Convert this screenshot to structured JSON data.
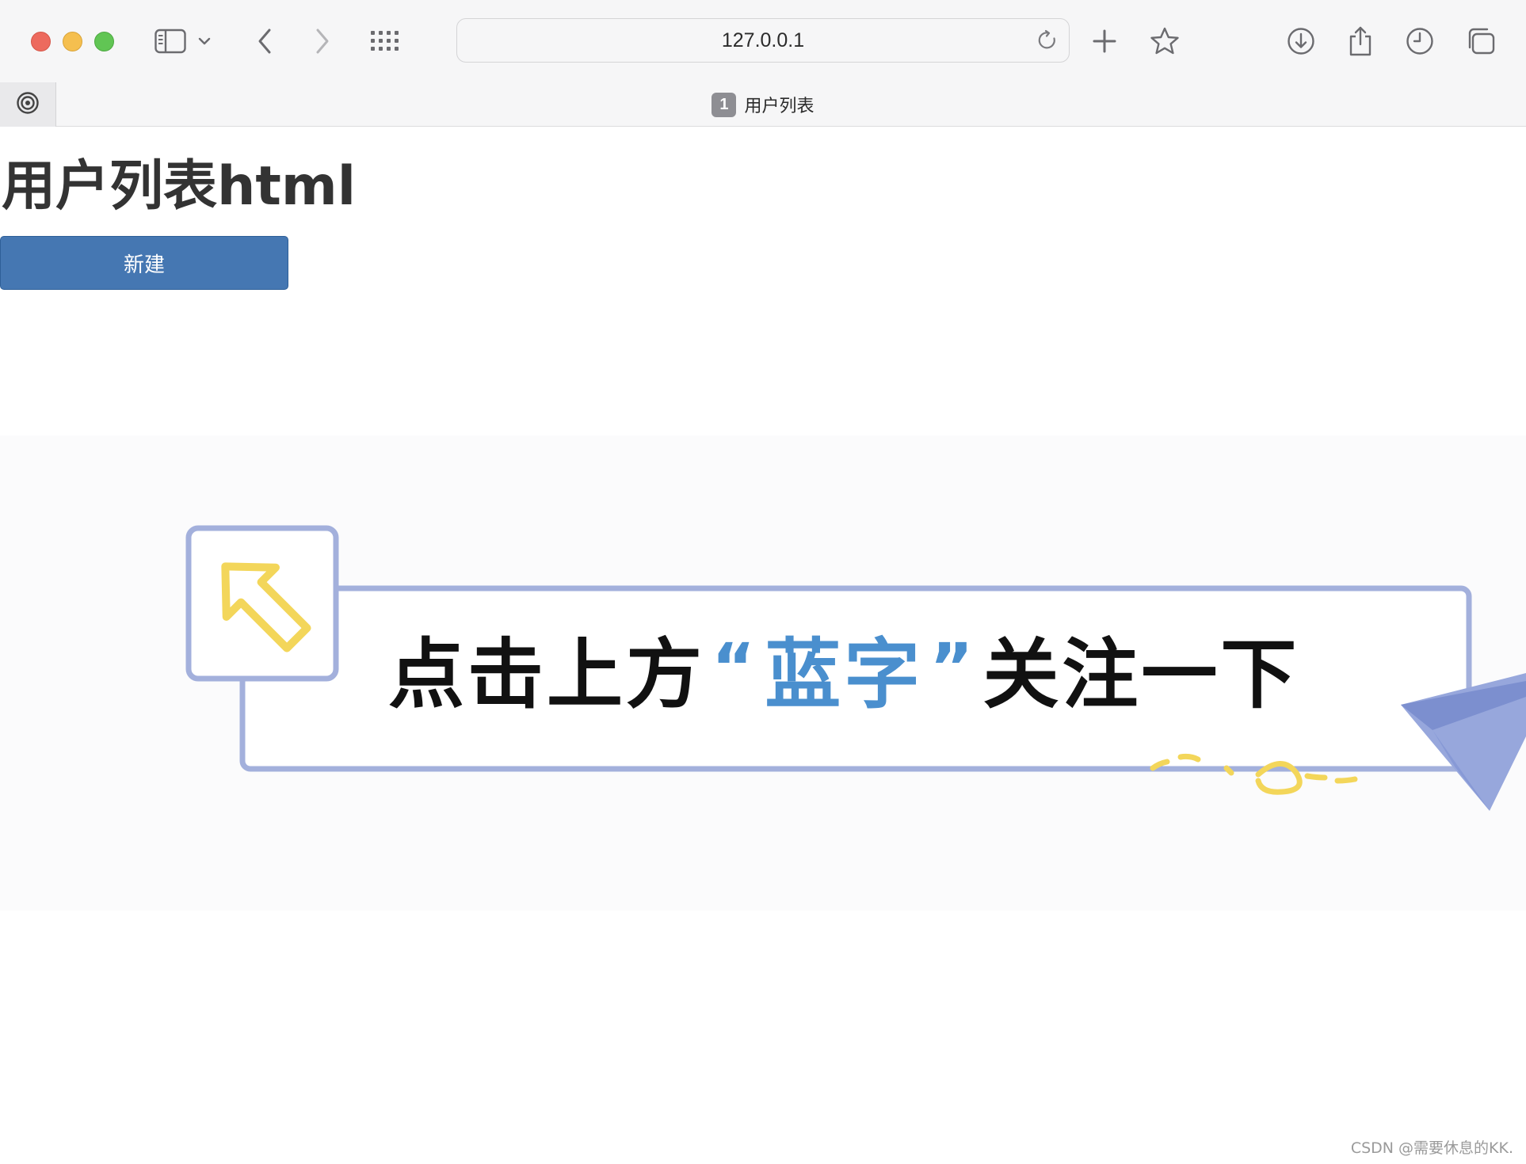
{
  "browser": {
    "url": "127.0.0.1",
    "tab": {
      "number": "1",
      "title": "用户列表"
    }
  },
  "page": {
    "heading": "用户列表html",
    "new_button_label": "新建"
  },
  "banner": {
    "part1": "点击上方",
    "quote_open": "“",
    "highlight": "蓝字",
    "quote_close": "”",
    "part2": "关注一下",
    "colors": {
      "frame": "#a3b0dc",
      "arrow": "#f3d65a",
      "highlight": "#4a8fce",
      "plane": "#97a7dc"
    }
  },
  "watermark": "CSDN @需要休息的KK."
}
